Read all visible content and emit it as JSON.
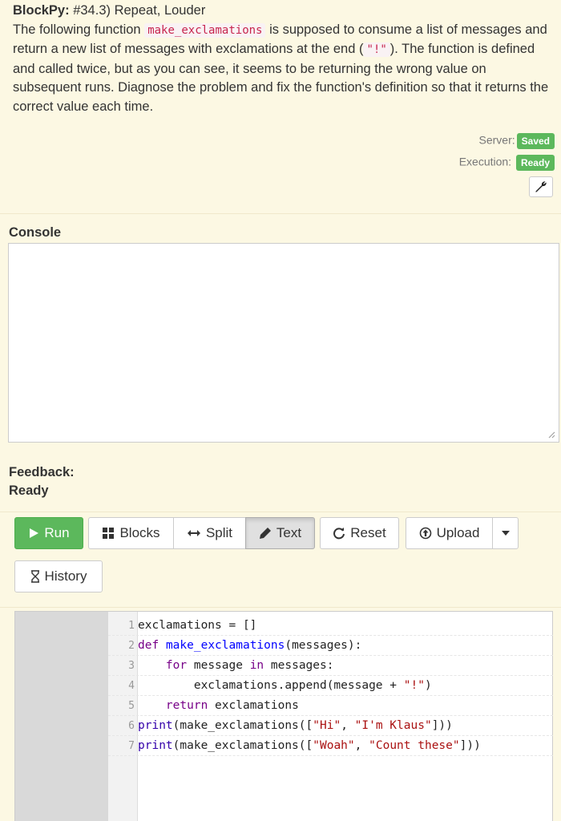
{
  "header": {
    "app": "BlockPy:",
    "title": "#34.3) Repeat, Louder",
    "desc_1": "The following function ",
    "desc_code_1": "make_exclamations",
    "desc_2": " is supposed to consume a list of messages and return a new list of messages with exclamations at the end (",
    "desc_code_2": "\"!\"",
    "desc_3": "). The function is defined and called twice, but as you can see, it seems to be returning the wrong value on subsequent runs. Diagnose the problem and fix the function's definition so that it returns the correct value each time."
  },
  "status": {
    "server_label": "Server:",
    "server_value": "Saved",
    "execution_label": "Execution:",
    "execution_value": "Ready",
    "badge_color": "#5cb85c"
  },
  "console": {
    "label": "Console"
  },
  "feedback": {
    "label": "Feedback:",
    "status": "Ready"
  },
  "toolbar": {
    "run": "Run",
    "blocks": "Blocks",
    "split": "Split",
    "text": "Text",
    "reset": "Reset",
    "upload": "Upload",
    "history": "History"
  },
  "editor": {
    "lines": [
      {
        "n": "1",
        "code": "exclamations = []"
      },
      {
        "n": "2",
        "code": "def make_exclamations(messages):"
      },
      {
        "n": "3",
        "code": "    for message in messages:"
      },
      {
        "n": "4",
        "code": "        exclamations.append(message + \"!\")"
      },
      {
        "n": "5",
        "code": "    return exclamations"
      },
      {
        "n": "6",
        "code": "print(make_exclamations([\"Hi\", \"I'm Klaus\"]))"
      },
      {
        "n": "7",
        "code": "print(make_exclamations([\"Woah\", \"Count these\"]))"
      }
    ]
  }
}
